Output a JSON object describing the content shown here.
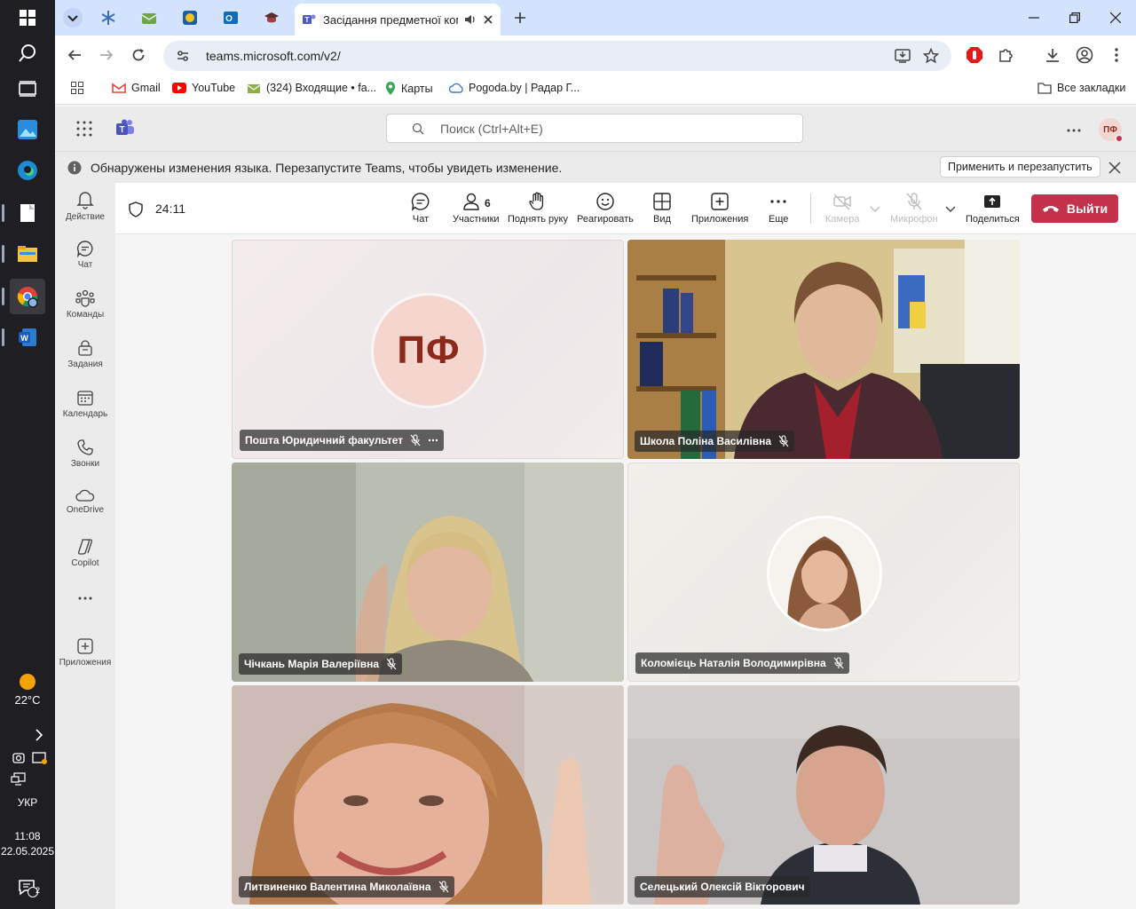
{
  "taskbar": {
    "weather_temp": "22°C",
    "lang": "УКР",
    "time": "11:08",
    "date": "22.05.2025",
    "notifications_count": "2"
  },
  "browser": {
    "active_tab_title": "Засідання предметної ком",
    "url": "teams.microsoft.com/v2/",
    "bookmarks": [
      {
        "label": "Gmail",
        "icon": "gmail-icon"
      },
      {
        "label": "YouTube",
        "icon": "youtube-icon"
      },
      {
        "label": "(324) Входящие • fa...",
        "icon": "mail-icon"
      },
      {
        "label": "Карты",
        "icon": "maps-icon"
      },
      {
        "label": "Pogoda.by | Радар Г...",
        "icon": "weather-icon"
      }
    ],
    "all_bookmarks": "Все закладки"
  },
  "teams": {
    "search_placeholder": "Поиск (Ctrl+Alt+E)",
    "user_initials": "ПФ",
    "banner_text": "Обнаружены изменения языка. Перезапустите Teams, чтобы увидеть изменение.",
    "banner_button": "Применить и перезапустить",
    "rail": [
      {
        "label": "Действие",
        "icon": "bell-icon"
      },
      {
        "label": "Чат",
        "icon": "chat-icon"
      },
      {
        "label": "Команды",
        "icon": "teams-icon"
      },
      {
        "label": "Задания",
        "icon": "assignments-icon"
      },
      {
        "label": "Календарь",
        "icon": "calendar-icon"
      },
      {
        "label": "Звонки",
        "icon": "phone-icon"
      },
      {
        "label": "OneDrive",
        "icon": "cloud-icon"
      },
      {
        "label": "Copilot",
        "icon": "copilot-icon"
      },
      {
        "label": "Приложения",
        "icon": "add-apps-icon"
      }
    ]
  },
  "meeting": {
    "timer": "24:11",
    "participants_count": "6",
    "toolbar": {
      "chat": "Чат",
      "participants": "Участники",
      "raise_hand": "Поднять руку",
      "react": "Реагировать",
      "view": "Вид",
      "apps": "Приложения",
      "more": "Еще",
      "camera": "Камера",
      "mic": "Микрофон",
      "share": "Поделиться",
      "leave": "Выйти"
    },
    "tiles": [
      {
        "name": "Пошта Юридичний факультет",
        "initials": "ПФ"
      },
      {
        "name": "Школа Поліна Василівна"
      },
      {
        "name": "Чічкань Марія Валеріївна"
      },
      {
        "name": "Коломієць Наталія Володимирівна"
      },
      {
        "name": "Литвиненко Валентина Миколаївна"
      },
      {
        "name": "Селецький Олексій Вікторович"
      }
    ]
  }
}
